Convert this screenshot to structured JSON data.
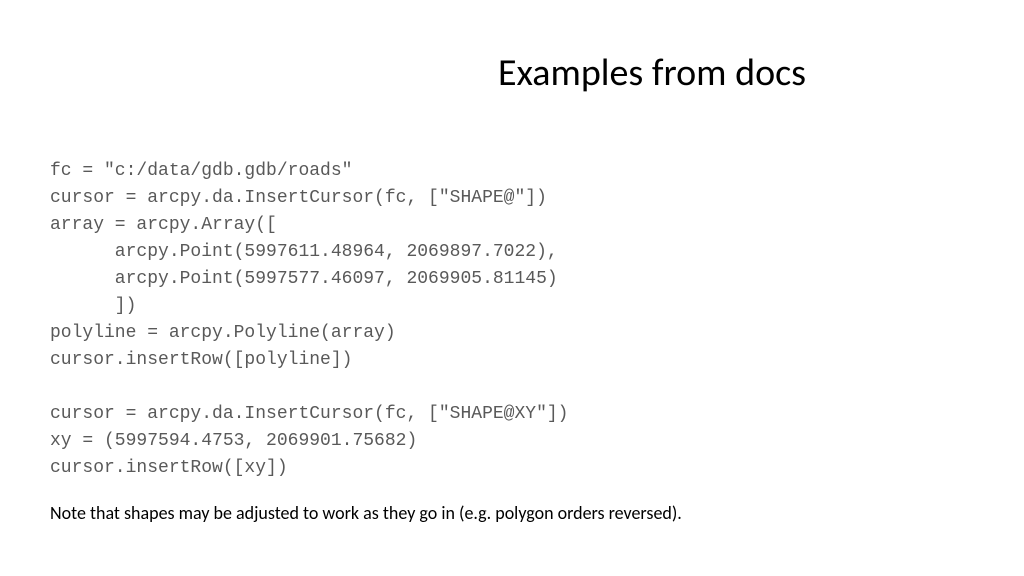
{
  "title": "Examples from docs",
  "code": {
    "line1": "fc = \"c:/data/gdb.gdb/roads\"",
    "line2": "cursor = arcpy.da.InsertCursor(fc, [\"SHAPE@\"])",
    "line3": "array = arcpy.Array([",
    "line4": "      arcpy.Point(5997611.48964, 2069897.7022),",
    "line5": "      arcpy.Point(5997577.46097, 2069905.81145)",
    "line6": "      ])",
    "line7": "polyline = arcpy.Polyline(array)",
    "line8": "cursor.insertRow([polyline])",
    "blank1": "",
    "line9": "cursor = arcpy.da.InsertCursor(fc, [\"SHAPE@XY\"])",
    "line10": "xy = (5997594.4753, 2069901.75682)",
    "line11": "cursor.insertRow([xy])"
  },
  "note": "Note that shapes may be adjusted to work as they go in (e.g. polygon orders reversed)."
}
